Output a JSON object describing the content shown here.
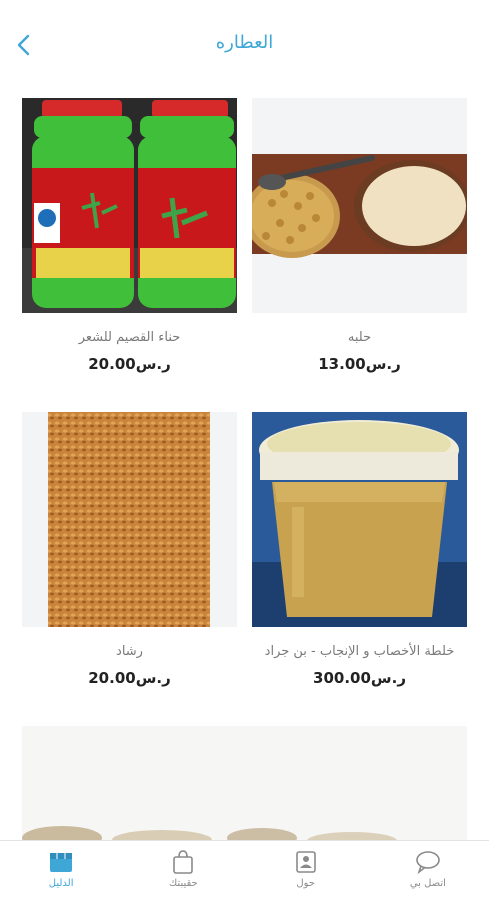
{
  "header": {
    "title": "العطاره",
    "back_icon": "chevron-left-icon"
  },
  "products": [
    {
      "name": "حناء القصيم للشعر",
      "price": "ر.س20.00",
      "image": "henna-jars"
    },
    {
      "name": "حلبه",
      "price": "ر.س13.00",
      "image": "fenugreek-seeds-and-powder"
    },
    {
      "name": "رشاد",
      "price": "ر.س20.00",
      "image": "cress-seeds"
    },
    {
      "name": "خلطة الأخصاب و الإنجاب - بن جراد",
      "price": "ر.س300.00",
      "image": "honey-mix-tub"
    }
  ],
  "tabbar": {
    "items": [
      {
        "label": "الدليل",
        "icon": "store-icon",
        "active": true
      },
      {
        "label": "حقيبتك",
        "icon": "shopping-bag-icon",
        "active": false
      },
      {
        "label": "حول",
        "icon": "contact-card-icon",
        "active": false
      },
      {
        "label": "اتصل بي",
        "icon": "chat-bubble-icon",
        "active": false
      }
    ]
  },
  "colors": {
    "accent": "#3fa7d6",
    "price": "#222222",
    "name": "#7a7a7a"
  }
}
